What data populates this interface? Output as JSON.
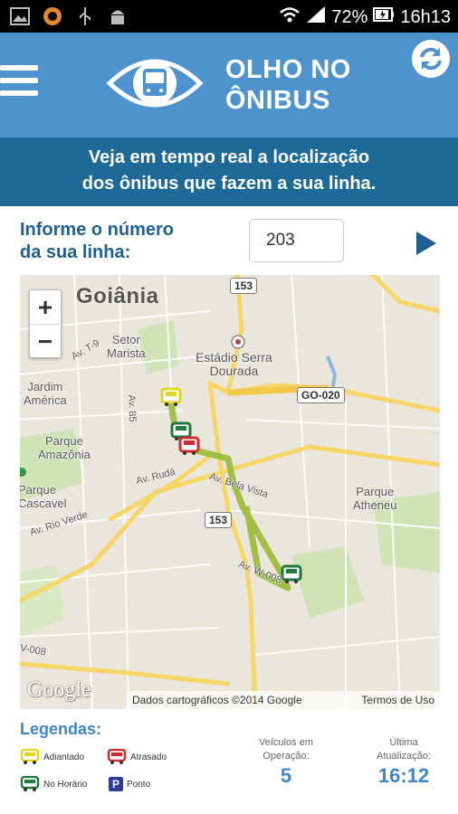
{
  "status_bar": {
    "icons": [
      "image-icon",
      "app-icon",
      "usb-icon",
      "android-icon"
    ],
    "battery": "72%",
    "time": "16h13"
  },
  "header": {
    "title_line1": "OLHO NO",
    "title_line2": "ÔNIBUS",
    "brand_color": "#4f93ce"
  },
  "banner": {
    "line1": "Veja em tempo real a localização",
    "line2": "dos ônibus que fazem a sua linha."
  },
  "form": {
    "label_line1": "Informe o número",
    "label_line2": "da sua linha:",
    "line_value": "203"
  },
  "map": {
    "city": "Goiânia",
    "labels": {
      "setor_marista": "Setor\nMarista",
      "estadio": "Estádio Serra\nDourada",
      "jardim_america": "Jardim\nAmérica",
      "parque_amazonia": "Parque\nAmazônia",
      "parque_atheneu": "Parque\nAtheneu",
      "av_ruda": "Av. Rudá",
      "av_rio_verde": "Av. Rio Verde",
      "av_bela_vista": "Av. Bela Vista",
      "av_w008": "Av. W-008",
      "av_85": "Av. 85",
      "av_t9": "Av. T-9",
      "av_v008": "V-008",
      "parque_cascavel": "Parque\nCascavel"
    },
    "shields": {
      "r153_top": "153",
      "r153_mid": "153",
      "go020": "GO-020"
    },
    "zoom_in": "+",
    "zoom_out": "−",
    "google": "Google",
    "attribution": "Dados cartográficos ©2014 Google",
    "terms": "Termos de Uso"
  },
  "legend": {
    "title": "Legendas:",
    "adiantado": "Adiantado",
    "atrasado": "Atrasado",
    "no_horario": "No Horário",
    "ponto": "Ponto",
    "ponto_letter": "P",
    "colors": {
      "adiantado": "#e2d51d",
      "atrasado": "#d12a2a",
      "no_horario": "#1f7a3b",
      "ponto": "#2a3c9e"
    }
  },
  "stats": {
    "vehicles_label1": "Veículos em",
    "vehicles_label2": "Operação:",
    "vehicles_value": "5",
    "update_label1": "Última",
    "update_label2": "Atualização:",
    "update_value": "16:12"
  }
}
